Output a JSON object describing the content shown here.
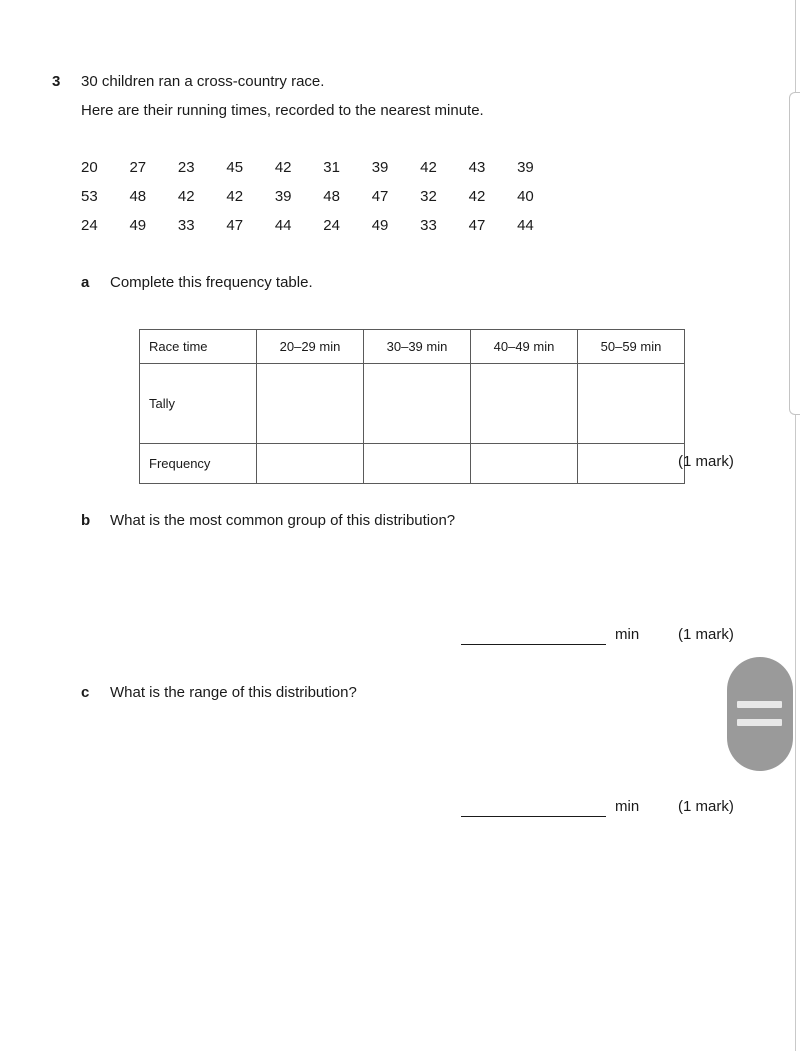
{
  "question": {
    "number": "3",
    "stem_line_1": "30 children ran a cross-country race.",
    "stem_line_2": "Here are their running times, recorded to the nearest minute."
  },
  "data_rows": [
    [
      "20",
      "27",
      "23",
      "45",
      "42",
      "31",
      "39",
      "42",
      "43",
      "39"
    ],
    [
      "53",
      "48",
      "42",
      "42",
      "39",
      "48",
      "47",
      "32",
      "42",
      "40"
    ],
    [
      "24",
      "49",
      "33",
      "47",
      "44",
      "24",
      "49",
      "33",
      "47",
      "44"
    ]
  ],
  "parts": [
    {
      "letter": "a",
      "text": "Complete this frequency table.",
      "mark": "(1 mark)"
    },
    {
      "letter": "b",
      "text": "What is the most common group of this distribution?",
      "mark": "(1 mark)",
      "unit": "min"
    },
    {
      "letter": "c",
      "text": "What is the range of this distribution?",
      "mark": "(1 mark)",
      "unit": "min"
    }
  ],
  "frequency_table": {
    "header": [
      "Race time",
      "20–29 min",
      "30–39 min",
      "40–49 min",
      "50–59 min"
    ],
    "rows": [
      {
        "label": "Tally",
        "cells": [
          "",
          "",
          "",
          ""
        ]
      },
      {
        "label": "Frequency",
        "cells": [
          "",
          "",
          "",
          ""
        ]
      }
    ]
  },
  "colors": {
    "text": "#1a1a1a",
    "table_border": "#5a5a5a",
    "handle_fill": "#9a9a9a",
    "handle_grip": "#e8e8e8",
    "scroll_track": "#c9c9c9"
  }
}
